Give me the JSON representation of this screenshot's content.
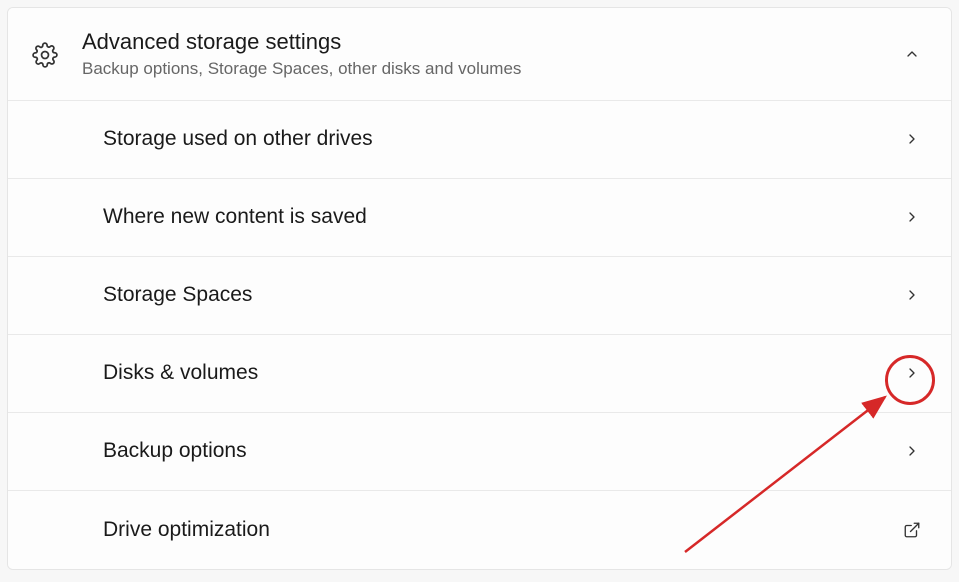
{
  "header": {
    "title": "Advanced storage settings",
    "subtitle": "Backup options, Storage Spaces, other disks and volumes",
    "icon": "gear-icon"
  },
  "items": [
    {
      "label": "Storage used on other drives",
      "action_icon": "chevron-right"
    },
    {
      "label": "Where new content is saved",
      "action_icon": "chevron-right"
    },
    {
      "label": "Storage Spaces",
      "action_icon": "chevron-right"
    },
    {
      "label": "Disks & volumes",
      "action_icon": "chevron-right"
    },
    {
      "label": "Backup options",
      "action_icon": "chevron-right"
    },
    {
      "label": "Drive optimization",
      "action_icon": "external-link"
    }
  ],
  "annotation": {
    "target_item_index": 3,
    "circle_color": "#d62828",
    "arrow_color": "#d62828"
  }
}
